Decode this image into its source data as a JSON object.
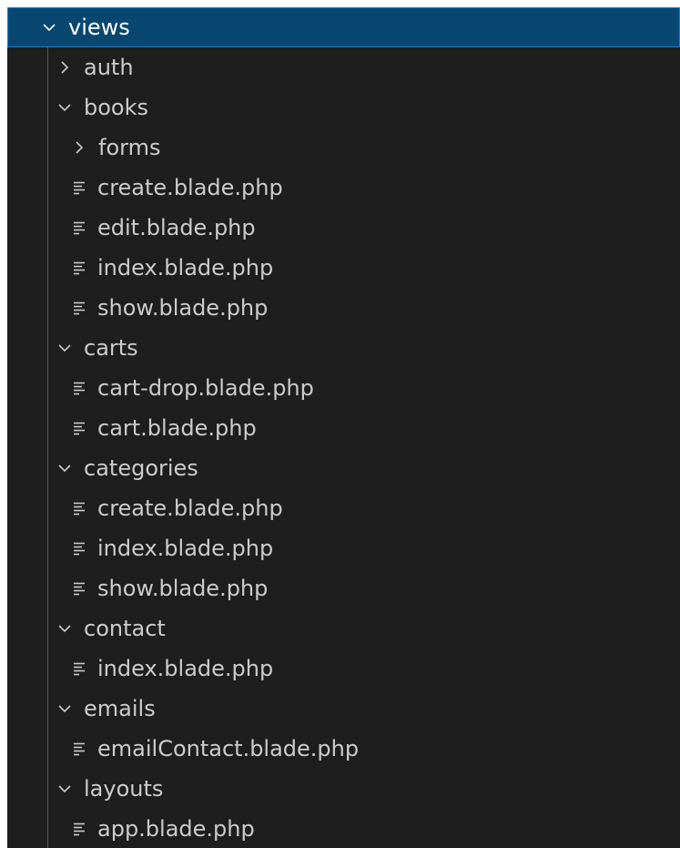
{
  "root": {
    "label": "views",
    "expanded": true
  },
  "items": [
    {
      "type": "folder",
      "label": "auth",
      "depth": 1,
      "expanded": false
    },
    {
      "type": "folder",
      "label": "books",
      "depth": 1,
      "expanded": true
    },
    {
      "type": "folder",
      "label": "forms",
      "depth": 2,
      "expanded": false
    },
    {
      "type": "file",
      "label": "create.blade.php",
      "depth": 2
    },
    {
      "type": "file",
      "label": "edit.blade.php",
      "depth": 2
    },
    {
      "type": "file",
      "label": "index.blade.php",
      "depth": 2
    },
    {
      "type": "file",
      "label": "show.blade.php",
      "depth": 2
    },
    {
      "type": "folder",
      "label": "carts",
      "depth": 1,
      "expanded": true
    },
    {
      "type": "file",
      "label": "cart-drop.blade.php",
      "depth": 2
    },
    {
      "type": "file",
      "label": "cart.blade.php",
      "depth": 2
    },
    {
      "type": "folder",
      "label": "categories",
      "depth": 1,
      "expanded": true
    },
    {
      "type": "file",
      "label": "create.blade.php",
      "depth": 2
    },
    {
      "type": "file",
      "label": "index.blade.php",
      "depth": 2
    },
    {
      "type": "file",
      "label": "show.blade.php",
      "depth": 2
    },
    {
      "type": "folder",
      "label": "contact",
      "depth": 1,
      "expanded": true
    },
    {
      "type": "file",
      "label": "index.blade.php",
      "depth": 2
    },
    {
      "type": "folder",
      "label": "emails",
      "depth": 1,
      "expanded": true
    },
    {
      "type": "file",
      "label": "emailContact.blade.php",
      "depth": 2
    },
    {
      "type": "folder",
      "label": "layouts",
      "depth": 1,
      "expanded": true
    },
    {
      "type": "file",
      "label": "app.blade.php",
      "depth": 2
    }
  ],
  "icons": {
    "folder_open": "chevron-down-icon",
    "folder_closed": "chevron-right-icon",
    "file": "file-lines-icon"
  },
  "colors": {
    "background": "#1e1e1e",
    "selected_row": "#094771",
    "selected_border": "#1f7ad0",
    "text": "#cccccc",
    "guide": "#585858"
  }
}
